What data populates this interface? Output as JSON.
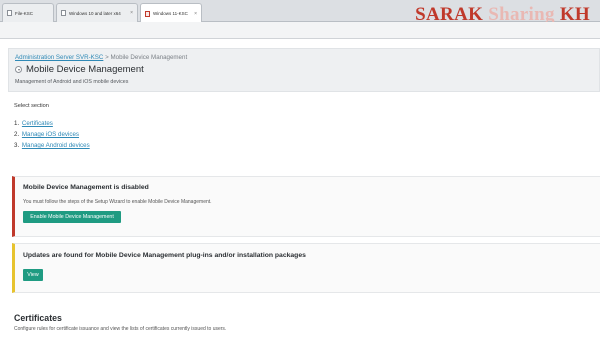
{
  "browser": {
    "tabs": [
      {
        "label": "File-KSC",
        "active": false
      },
      {
        "label": "Windows 10 and later x64",
        "active": false
      },
      {
        "label": "Windows 11-KSC",
        "active": true
      }
    ],
    "watermark": {
      "part1": "SARAK",
      "part2": "Sharing",
      "part3": "KH"
    }
  },
  "header": {
    "breadcrumb_link": "Administration Server SVR-KSC",
    "breadcrumb_separator": ">",
    "breadcrumb_current": "Mobile Device Management",
    "title": "Mobile Device Management",
    "subtitle": "Management of Android and iOS mobile devices"
  },
  "sections": {
    "label": "Select section",
    "items": [
      {
        "num": "1.",
        "label": "Certificates"
      },
      {
        "num": "2.",
        "label": "Manage iOS devices"
      },
      {
        "num": "3.",
        "label": "Manage Android devices"
      }
    ]
  },
  "notice_disabled": {
    "title": "Mobile Device Management is disabled",
    "text": "You must follow the steps of the Setup Wizard to enable Mobile Device Management.",
    "button": "Enable Mobile Device Management",
    "accent": "#c0392b"
  },
  "notice_updates": {
    "title": "Updates are found for Mobile Device Management plug-ins and/or installation packages",
    "button": "View",
    "accent": "#e7c32e"
  },
  "certificates": {
    "title": "Certificates",
    "description": "Configure rules for certificate issuance and view the lists of certificates currently issued to users."
  },
  "colors": {
    "link": "#2f89b6",
    "button": "#1f9b82"
  }
}
